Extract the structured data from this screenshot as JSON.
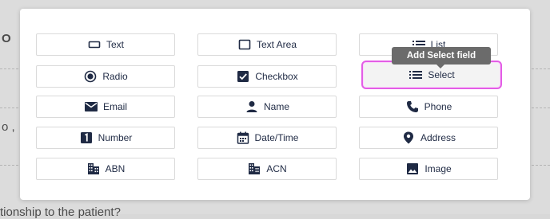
{
  "background": {
    "left_fragment_1": "O",
    "left_fragment_2": "o ,",
    "bottom_text": "tionship to the patient?"
  },
  "tooltip": {
    "text": "Add Select field"
  },
  "fields": {
    "text": {
      "label": "Text",
      "icon": "input-box-icon"
    },
    "text_area": {
      "label": "Text Area",
      "icon": "textarea-box-icon"
    },
    "list": {
      "label": "List",
      "icon": "list-icon"
    },
    "radio": {
      "label": "Radio",
      "icon": "radio-button-icon"
    },
    "checkbox": {
      "label": "Checkbox",
      "icon": "checkbox-checked-icon"
    },
    "select": {
      "label": "Select",
      "icon": "list-icon"
    },
    "email": {
      "label": "Email",
      "icon": "envelope-icon"
    },
    "name": {
      "label": "Name",
      "icon": "person-icon"
    },
    "phone": {
      "label": "Phone",
      "icon": "phone-icon"
    },
    "number": {
      "label": "Number",
      "icon": "number-one-icon"
    },
    "date_time": {
      "label": "Date/Time",
      "icon": "calendar-icon"
    },
    "address": {
      "label": "Address",
      "icon": "map-pin-icon"
    },
    "abn": {
      "label": "ABN",
      "icon": "building-icon"
    },
    "acn": {
      "label": "ACN",
      "icon": "building-icon"
    },
    "image": {
      "label": "Image",
      "icon": "image-icon"
    }
  },
  "colors": {
    "accent": "#e35de6",
    "text": "#1f2a44",
    "tooltip_bg": "#6b6b6b"
  }
}
